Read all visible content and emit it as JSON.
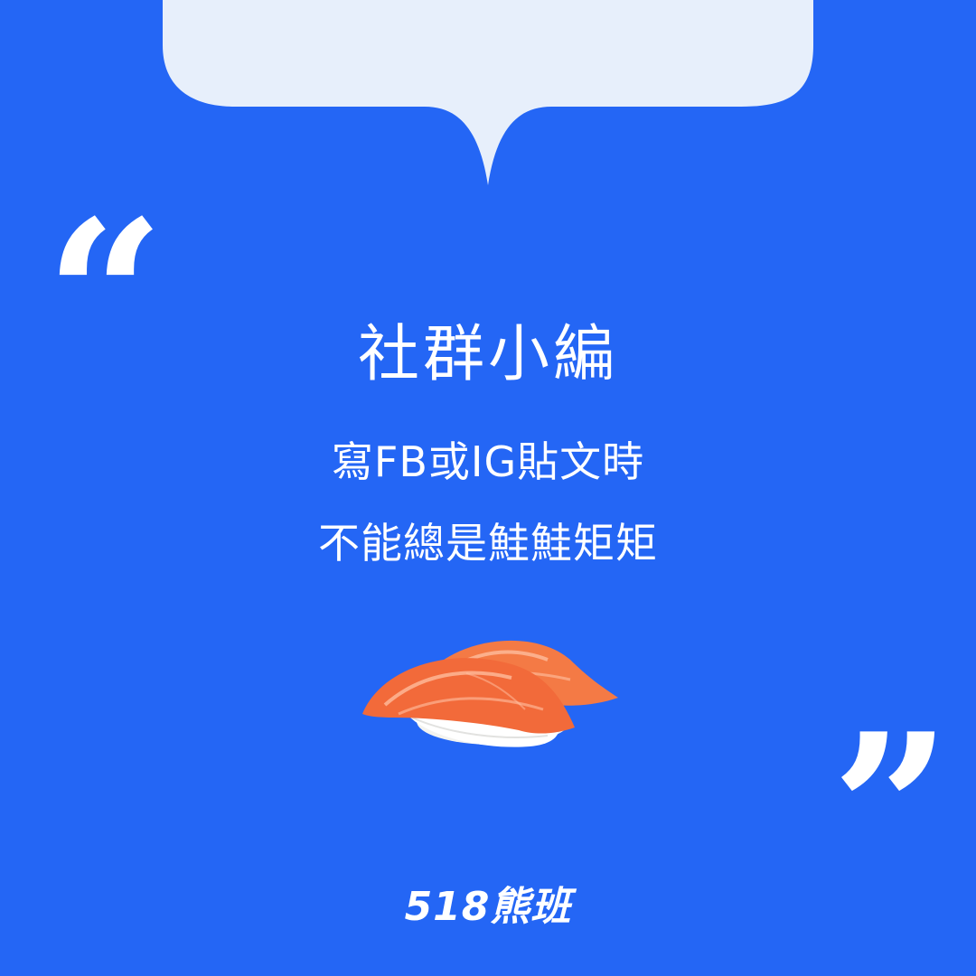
{
  "colors": {
    "background": "#2466f5",
    "bubble": "#e7effb",
    "text": "#ffffff",
    "salmon": "#f26a3a",
    "rice": "#ffffff"
  },
  "quote_marks": {
    "open": "“",
    "close": "”"
  },
  "headline": "社群小編",
  "body_lines": [
    "寫FB或IG貼文時",
    "不能總是鮭鮭矩矩"
  ],
  "brand": "518熊班",
  "icons": {
    "speech_bubble": "speech-bubble-shape",
    "sushi": "salmon-nigiri-illustration"
  }
}
